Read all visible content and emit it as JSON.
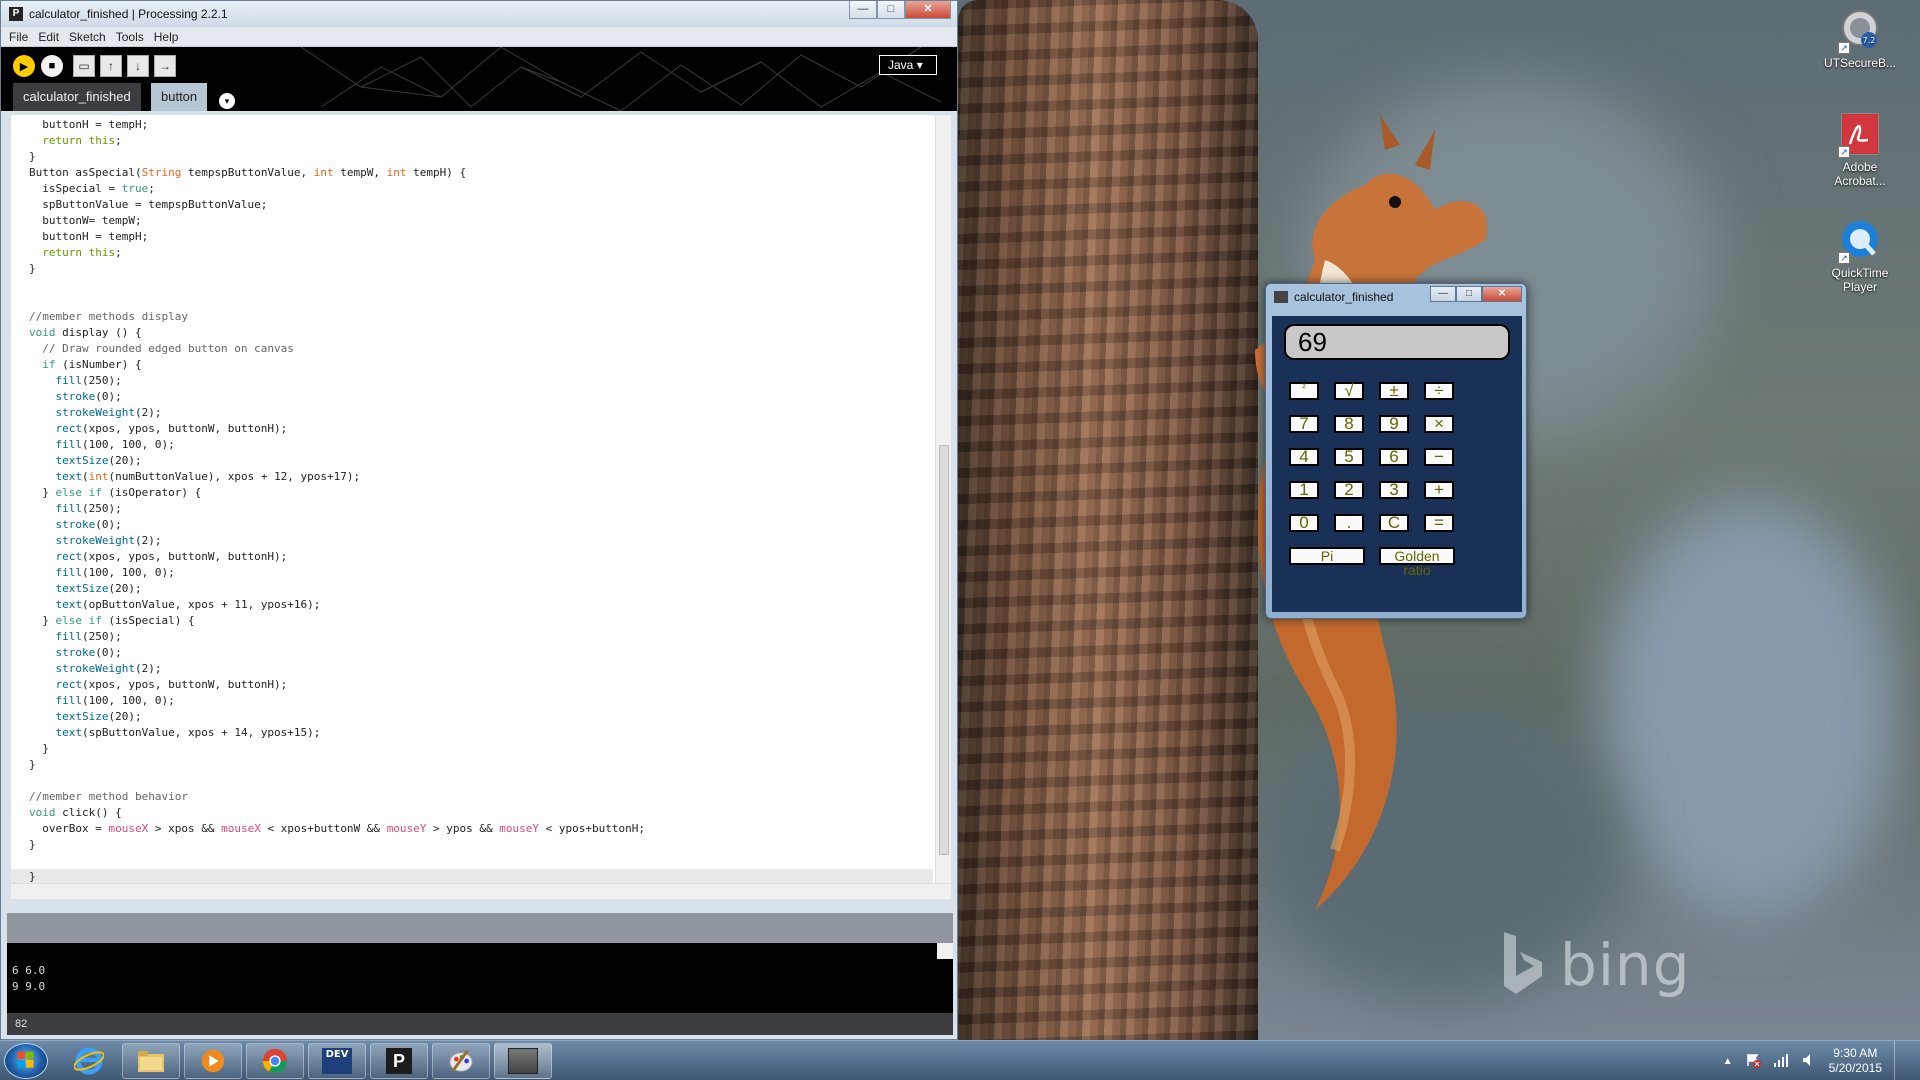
{
  "ide": {
    "title": "calculator_finished | Processing 2.2.1",
    "app_icon": "P",
    "menu": [
      "File",
      "Edit",
      "Sketch",
      "Tools",
      "Help"
    ],
    "mode": "Java",
    "tabs": [
      {
        "label": "calculator_finished",
        "active": true
      },
      {
        "label": "button",
        "active": false
      }
    ],
    "code": [
      "  buttonH = tempH;",
      "  return this;",
      "}",
      "Button asSpecial(String tempspButtonValue, int tempW, int tempH) {",
      "  isSpecial = true;",
      "  spButtonValue = tempspButtonValue;",
      "  buttonW= tempW;",
      "  buttonH = tempH;",
      "  return this;",
      "}",
      "",
      "",
      "//member methods display",
      "void display () {",
      "  // Draw rounded edged button on canvas",
      "  if (isNumber) {",
      "    fill(250);",
      "    stroke(0);",
      "    strokeWeight(2);",
      "    rect(xpos, ypos, buttonW, buttonH);",
      "    fill(100, 100, 0);",
      "    textSize(20);",
      "    text(int(numButtonValue), xpos + 12, ypos+17);",
      "  } else if (isOperator) {",
      "    fill(250);",
      "    stroke(0);",
      "    strokeWeight(2);",
      "    rect(xpos, ypos, buttonW, buttonH);",
      "    fill(100, 100, 0);",
      "    textSize(20);",
      "    text(opButtonValue, xpos + 11, ypos+16);",
      "  } else if (isSpecial) {",
      "    fill(250);",
      "    stroke(0);",
      "    strokeWeight(2);",
      "    rect(xpos, ypos, buttonW, buttonH);",
      "    fill(100, 100, 0);",
      "    textSize(20);",
      "    text(spButtonValue, xpos + 14, ypos+15);",
      "  }",
      "}",
      "",
      "//member method behavior",
      "void click() {",
      "  overBox = mouseX > xpos && mouseX < xpos+buttonW && mouseY > ypos && mouseY < ypos+buttonH;",
      "}",
      "",
      "}"
    ],
    "console": [
      "6 6.0",
      "9 9.0"
    ],
    "line_number": "82"
  },
  "calculator": {
    "title": "calculator_finished",
    "display": "69",
    "rows": [
      [
        "²",
        "√",
        "±",
        "÷"
      ],
      [
        "7",
        "8",
        "9",
        "×"
      ],
      [
        "4",
        "5",
        "6",
        "−"
      ],
      [
        "1",
        "2",
        "3",
        "+"
      ],
      [
        "0",
        ".",
        "C",
        "="
      ]
    ],
    "special": [
      "Pi",
      "Golden ratio"
    ]
  },
  "desktop_icons": [
    {
      "label": "UTSecureB...",
      "icon": "vpn-client-icon"
    },
    {
      "label": "Adobe Acrobat...",
      "icon": "adobe-acrobat-icon"
    },
    {
      "label": "QuickTime Player",
      "icon": "quicktime-icon"
    }
  ],
  "wallpaper_text": "bing",
  "taskbar": {
    "apps": [
      "internet-explorer",
      "file-explorer",
      "media-player",
      "chrome",
      "dev-cpp",
      "processing",
      "paint",
      "calculator-sketch"
    ],
    "dev_label": "DEV",
    "processing_label": "P",
    "clock_time": "9:30 AM",
    "clock_date": "5/20/2015"
  },
  "colors": {
    "processing_run": "#ffcc00",
    "calc_canvas": "#1a3157",
    "calc_button_text": "#646400"
  }
}
